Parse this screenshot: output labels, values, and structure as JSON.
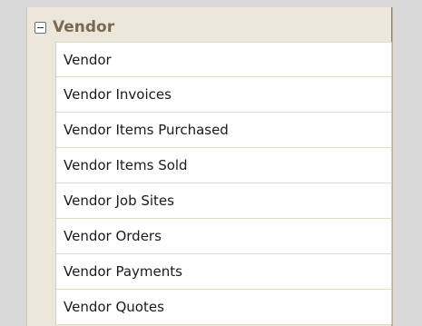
{
  "group": {
    "title": "Vendor",
    "expanded": true,
    "toggle_icon": "collapse-minus-icon",
    "items": [
      {
        "label": "Vendor"
      },
      {
        "label": "Vendor Invoices"
      },
      {
        "label": "Vendor Items Purchased"
      },
      {
        "label": "Vendor Items Sold"
      },
      {
        "label": "Vendor Job Sites"
      },
      {
        "label": "Vendor Orders"
      },
      {
        "label": "Vendor Payments"
      },
      {
        "label": "Vendor Quotes"
      }
    ]
  }
}
